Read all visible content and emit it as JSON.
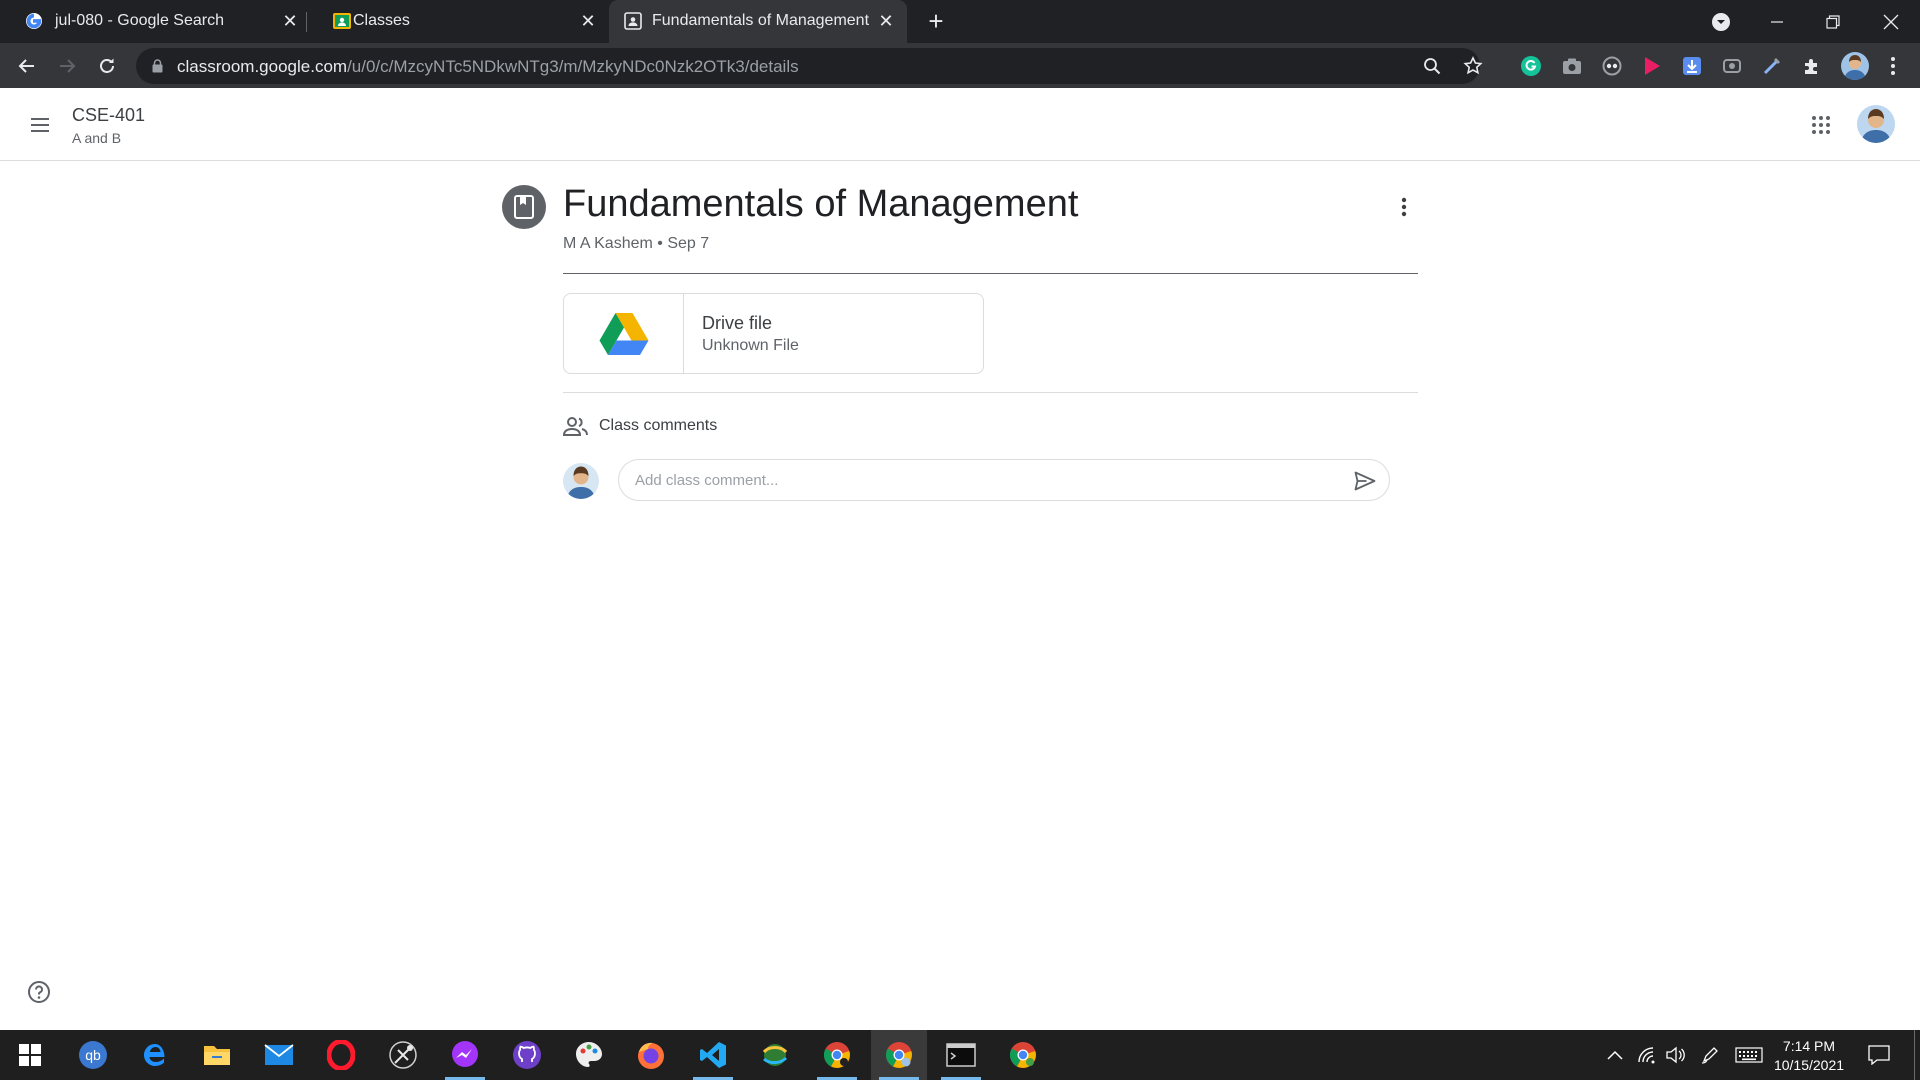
{
  "browser": {
    "tabs": [
      {
        "title": "jul-080 - Google Search",
        "favicon": "google-g-icon",
        "active": false
      },
      {
        "title": "Classes",
        "favicon": "classroom-icon",
        "active": false
      },
      {
        "title": "Fundamentals of Management",
        "favicon": "classroom-material-icon",
        "active": true
      }
    ],
    "address": {
      "host": "classroom.google.com",
      "path": "/u/0/c/MzcyNTc5NDkwNTg3/m/MzkyNDc0Nzk2OTk3/details"
    }
  },
  "header": {
    "class_name": "CSE-401",
    "section": "A and B"
  },
  "material": {
    "title": "Fundamentals of Management",
    "author": "M A Kashem",
    "date": "Sep 7",
    "separator": "•",
    "attachment": {
      "title": "Drive file",
      "subtitle": "Unknown File"
    }
  },
  "comments": {
    "heading": "Class comments",
    "placeholder": "Add class comment..."
  },
  "taskbar": {
    "time": "7:14 PM",
    "date": "10/15/2021"
  },
  "colors": {
    "chrome_dark": "#202124",
    "chrome_toolbar": "#35363a",
    "drive_green": "#0f9d58",
    "drive_yellow": "#f4b400",
    "drive_blue": "#4285f4",
    "taskbar": "#1f1f1f"
  }
}
